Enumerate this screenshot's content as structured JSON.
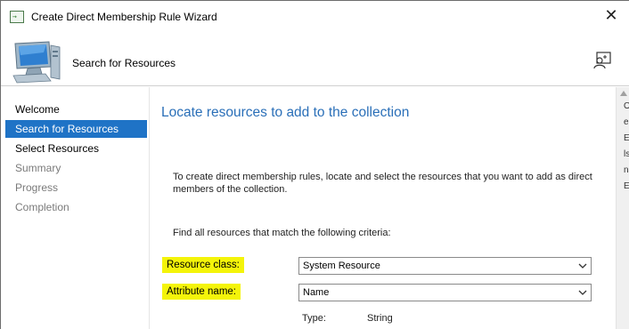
{
  "window": {
    "title": "Create Direct Membership Rule Wizard",
    "close_glyph": "✕",
    "icon": "wizard-app-icon",
    "icon_glyph": "→"
  },
  "header": {
    "title": "Search for Resources",
    "icon": "computer-icon",
    "help_icon": "help-person-icon"
  },
  "nav": {
    "items": [
      {
        "label": "Welcome",
        "state": "normal"
      },
      {
        "label": "Search for Resources",
        "state": "active"
      },
      {
        "label": "Select Resources",
        "state": "normal"
      },
      {
        "label": "Summary",
        "state": "disabled"
      },
      {
        "label": "Progress",
        "state": "disabled"
      },
      {
        "label": "Completion",
        "state": "disabled"
      }
    ]
  },
  "main": {
    "heading": "Locate resources to add to the collection",
    "description": "To create direct membership rules, locate and select the resources that you want to add as direct members of the collection.",
    "criteria_text": "Find all resources that match the following criteria:",
    "resource_class": {
      "label": "Resource class:",
      "value": "System Resource"
    },
    "attribute_name": {
      "label": "Attribute name:",
      "value": "Name"
    },
    "type": {
      "label": "Type:",
      "value": "String"
    }
  },
  "background_strip": [
    "O",
    "e",
    "E",
    "ls",
    "",
    "ns",
    "",
    "E"
  ],
  "colors": {
    "accent": "#1f73c6",
    "heading": "#2a6fb8",
    "highlight": "#f4f40a"
  }
}
